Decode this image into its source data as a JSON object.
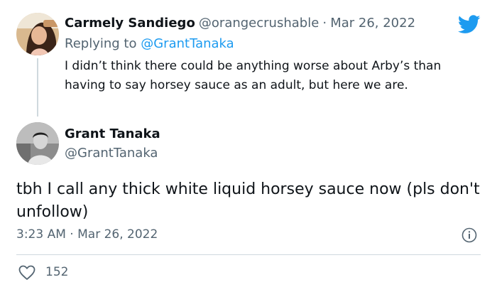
{
  "reply_tweet": {
    "display_name": "Carmely Sandiego",
    "handle": "@orangecrushable",
    "separator": "·",
    "date": "Mar 26, 2022",
    "replying_prefix": "Replying to",
    "replying_to": "@GrantTanaka",
    "text": "I didn’t think there could be anything worse about Arby’s than having to say horsey sauce as an adult, but here we are."
  },
  "main_tweet": {
    "display_name": "Grant Tanaka",
    "handle": "@GrantTanaka",
    "text": "tbh I call any thick white liquid horsey sauce now (pls don't unfollow)",
    "time": "3:23 AM",
    "separator": "·",
    "date": "Mar 26, 2022"
  },
  "actions": {
    "like_count": "152"
  },
  "icons": {
    "brand": "twitter-bird-icon",
    "info": "info-icon",
    "like": "heart-icon"
  },
  "colors": {
    "brand_blue": "#1d9bf0",
    "text_primary": "#0f1419",
    "text_secondary": "#536471",
    "divider": "#cfd9de"
  }
}
